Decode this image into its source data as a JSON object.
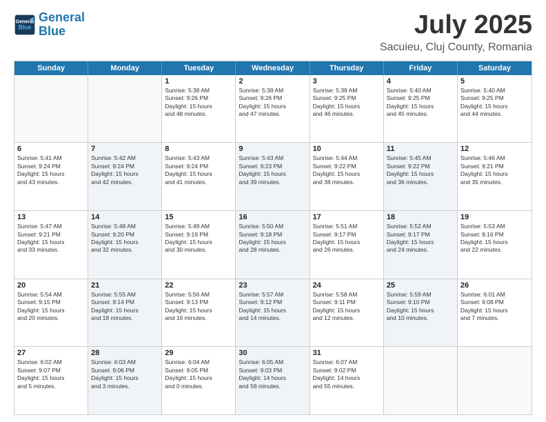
{
  "logo": {
    "line1": "General",
    "line2": "Blue"
  },
  "title": "July 2025",
  "subtitle": "Sacuieu, Cluj County, Romania",
  "weekdays": [
    "Sunday",
    "Monday",
    "Tuesday",
    "Wednesday",
    "Thursday",
    "Friday",
    "Saturday"
  ],
  "rows": [
    [
      {
        "day": "",
        "lines": [],
        "empty": true
      },
      {
        "day": "",
        "lines": [],
        "empty": true
      },
      {
        "day": "1",
        "lines": [
          "Sunrise: 5:38 AM",
          "Sunset: 9:26 PM",
          "Daylight: 15 hours",
          "and 48 minutes."
        ]
      },
      {
        "day": "2",
        "lines": [
          "Sunrise: 5:38 AM",
          "Sunset: 9:26 PM",
          "Daylight: 15 hours",
          "and 47 minutes."
        ]
      },
      {
        "day": "3",
        "lines": [
          "Sunrise: 5:39 AM",
          "Sunset: 9:25 PM",
          "Daylight: 15 hours",
          "and 46 minutes."
        ]
      },
      {
        "day": "4",
        "lines": [
          "Sunrise: 5:40 AM",
          "Sunset: 9:25 PM",
          "Daylight: 15 hours",
          "and 45 minutes."
        ]
      },
      {
        "day": "5",
        "lines": [
          "Sunrise: 5:40 AM",
          "Sunset: 9:25 PM",
          "Daylight: 15 hours",
          "and 44 minutes."
        ]
      }
    ],
    [
      {
        "day": "6",
        "lines": [
          "Sunrise: 5:41 AM",
          "Sunset: 9:24 PM",
          "Daylight: 15 hours",
          "and 43 minutes."
        ]
      },
      {
        "day": "7",
        "lines": [
          "Sunrise: 5:42 AM",
          "Sunset: 9:24 PM",
          "Daylight: 15 hours",
          "and 42 minutes."
        ],
        "alt": true
      },
      {
        "day": "8",
        "lines": [
          "Sunrise: 5:43 AM",
          "Sunset: 9:24 PM",
          "Daylight: 15 hours",
          "and 41 minutes."
        ]
      },
      {
        "day": "9",
        "lines": [
          "Sunrise: 5:43 AM",
          "Sunset: 9:23 PM",
          "Daylight: 15 hours",
          "and 39 minutes."
        ],
        "alt": true
      },
      {
        "day": "10",
        "lines": [
          "Sunrise: 5:44 AM",
          "Sunset: 9:22 PM",
          "Daylight: 15 hours",
          "and 38 minutes."
        ]
      },
      {
        "day": "11",
        "lines": [
          "Sunrise: 5:45 AM",
          "Sunset: 9:22 PM",
          "Daylight: 15 hours",
          "and 36 minutes."
        ],
        "alt": true
      },
      {
        "day": "12",
        "lines": [
          "Sunrise: 5:46 AM",
          "Sunset: 9:21 PM",
          "Daylight: 15 hours",
          "and 35 minutes."
        ]
      }
    ],
    [
      {
        "day": "13",
        "lines": [
          "Sunrise: 5:47 AM",
          "Sunset: 9:21 PM",
          "Daylight: 15 hours",
          "and 33 minutes."
        ]
      },
      {
        "day": "14",
        "lines": [
          "Sunrise: 5:48 AM",
          "Sunset: 9:20 PM",
          "Daylight: 15 hours",
          "and 32 minutes."
        ],
        "alt": true
      },
      {
        "day": "15",
        "lines": [
          "Sunrise: 5:49 AM",
          "Sunset: 9:19 PM",
          "Daylight: 15 hours",
          "and 30 minutes."
        ]
      },
      {
        "day": "16",
        "lines": [
          "Sunrise: 5:50 AM",
          "Sunset: 9:18 PM",
          "Daylight: 15 hours",
          "and 28 minutes."
        ],
        "alt": true
      },
      {
        "day": "17",
        "lines": [
          "Sunrise: 5:51 AM",
          "Sunset: 9:17 PM",
          "Daylight: 15 hours",
          "and 26 minutes."
        ]
      },
      {
        "day": "18",
        "lines": [
          "Sunrise: 5:52 AM",
          "Sunset: 9:17 PM",
          "Daylight: 15 hours",
          "and 24 minutes."
        ],
        "alt": true
      },
      {
        "day": "19",
        "lines": [
          "Sunrise: 5:53 AM",
          "Sunset: 9:16 PM",
          "Daylight: 15 hours",
          "and 22 minutes."
        ]
      }
    ],
    [
      {
        "day": "20",
        "lines": [
          "Sunrise: 5:54 AM",
          "Sunset: 9:15 PM",
          "Daylight: 15 hours",
          "and 20 minutes."
        ]
      },
      {
        "day": "21",
        "lines": [
          "Sunrise: 5:55 AM",
          "Sunset: 9:14 PM",
          "Daylight: 15 hours",
          "and 18 minutes."
        ],
        "alt": true
      },
      {
        "day": "22",
        "lines": [
          "Sunrise: 5:56 AM",
          "Sunset: 9:13 PM",
          "Daylight: 15 hours",
          "and 16 minutes."
        ]
      },
      {
        "day": "23",
        "lines": [
          "Sunrise: 5:57 AM",
          "Sunset: 9:12 PM",
          "Daylight: 15 hours",
          "and 14 minutes."
        ],
        "alt": true
      },
      {
        "day": "24",
        "lines": [
          "Sunrise: 5:58 AM",
          "Sunset: 9:11 PM",
          "Daylight: 15 hours",
          "and 12 minutes."
        ]
      },
      {
        "day": "25",
        "lines": [
          "Sunrise: 5:59 AM",
          "Sunset: 9:10 PM",
          "Daylight: 15 hours",
          "and 10 minutes."
        ],
        "alt": true
      },
      {
        "day": "26",
        "lines": [
          "Sunrise: 6:01 AM",
          "Sunset: 9:08 PM",
          "Daylight: 15 hours",
          "and 7 minutes."
        ]
      }
    ],
    [
      {
        "day": "27",
        "lines": [
          "Sunrise: 6:02 AM",
          "Sunset: 9:07 PM",
          "Daylight: 15 hours",
          "and 5 minutes."
        ]
      },
      {
        "day": "28",
        "lines": [
          "Sunrise: 6:03 AM",
          "Sunset: 9:06 PM",
          "Daylight: 15 hours",
          "and 3 minutes."
        ],
        "alt": true
      },
      {
        "day": "29",
        "lines": [
          "Sunrise: 6:04 AM",
          "Sunset: 9:05 PM",
          "Daylight: 15 hours",
          "and 0 minutes."
        ]
      },
      {
        "day": "30",
        "lines": [
          "Sunrise: 6:05 AM",
          "Sunset: 9:03 PM",
          "Daylight: 14 hours",
          "and 58 minutes."
        ],
        "alt": true
      },
      {
        "day": "31",
        "lines": [
          "Sunrise: 6:07 AM",
          "Sunset: 9:02 PM",
          "Daylight: 14 hours",
          "and 55 minutes."
        ]
      },
      {
        "day": "",
        "lines": [],
        "empty": true
      },
      {
        "day": "",
        "lines": [],
        "empty": true
      }
    ]
  ]
}
